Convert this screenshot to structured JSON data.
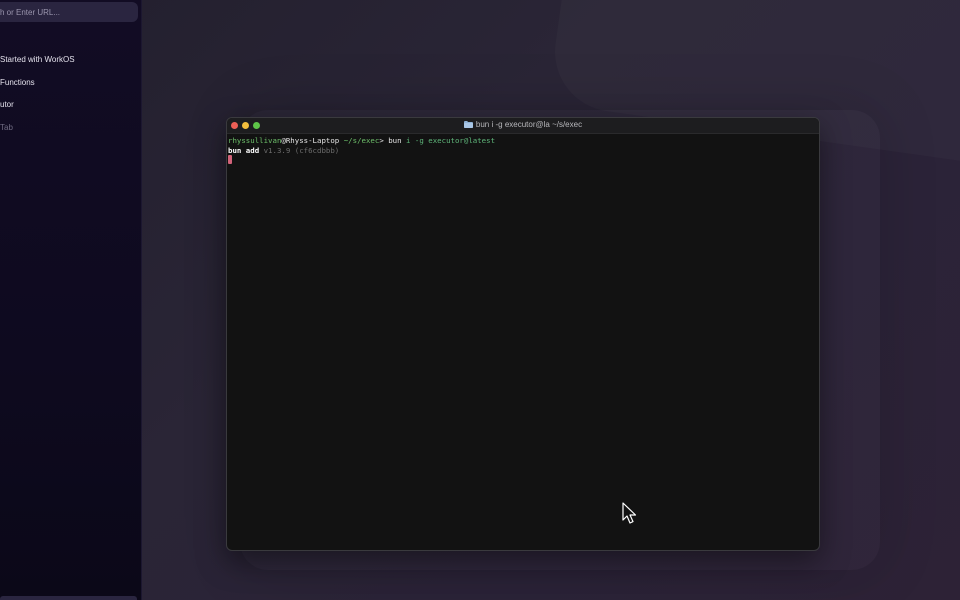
{
  "sidebar": {
    "url_placeholder": "h or Enter URL...",
    "items": [
      {
        "label": "Started with WorkOS"
      },
      {
        "label": "Functions"
      },
      {
        "label": "utor"
      },
      {
        "label": "Tab"
      }
    ]
  },
  "terminal": {
    "title": "bun i -g executor@la ~/s/exec",
    "title_icon": "folder-icon",
    "lines": {
      "prompt_user": "rhyssullivan",
      "prompt_at": "@Rhyss-Laptop",
      "prompt_path": " ~/s/exec",
      "prompt_symbol": "> ",
      "command_bin": "bun",
      "command_args": " i -g executor@latest",
      "output_cmd": "bun add",
      "output_version": " v1.3.9 (cf6cdbbb)"
    }
  },
  "colors": {
    "accent_green": "#6dbf6a",
    "cursor": "#d2637a",
    "close": "#ec5f56",
    "minimize": "#f3be3d",
    "maximize": "#5ec548"
  }
}
